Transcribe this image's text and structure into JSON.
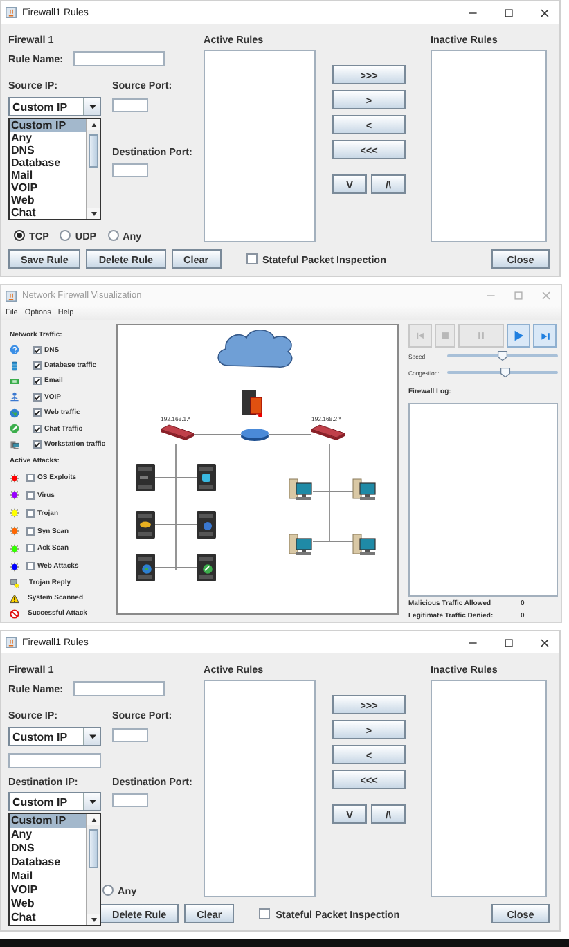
{
  "windows": [
    {
      "kind": "rules",
      "title": "Firewall1 Rules",
      "heading": "Firewall 1",
      "rule_name_label": "Rule Name:",
      "source_ip": {
        "label": "Source IP:",
        "value": "Custom IP",
        "list_open": true
      },
      "source_port_label": "Source Port:",
      "destination_port_label": "Destination Port:",
      "open_list": {
        "options": [
          {
            "label": "Custom IP",
            "selected": true
          },
          {
            "label": "Any",
            "selected": false
          },
          {
            "label": "DNS",
            "selected": false
          },
          {
            "label": "Database",
            "selected": false
          },
          {
            "label": "Mail",
            "selected": false
          },
          {
            "label": "VOIP",
            "selected": false
          },
          {
            "label": "Web",
            "selected": false
          },
          {
            "label": "Chat",
            "selected": false
          }
        ]
      },
      "protocols": [
        {
          "label": "TCP",
          "selected": true
        },
        {
          "label": "UDP",
          "selected": false
        },
        {
          "label": "Any",
          "selected": false
        }
      ],
      "active_rules_label": "Active Rules",
      "inactive_rules_label": "Inactive Rules",
      "move_buttons": [
        ">>>",
        ">",
        "<",
        "<<<"
      ],
      "order_buttons": [
        "V",
        "/\\"
      ],
      "actions": [
        "Save Rule",
        "Delete Rule",
        "Clear"
      ],
      "stateful_inspection": {
        "label": "Stateful Packet Inspection",
        "checked": false
      },
      "close_button": "Close"
    },
    {
      "kind": "visualization",
      "title": "Network Firewall Visualization",
      "menu": [
        "File",
        "Options",
        "Help"
      ],
      "traffic_heading": "Network Traffic:",
      "traffic": [
        {
          "kind": "dns",
          "label": "DNS",
          "checked": true
        },
        {
          "kind": "database",
          "label": "Database traffic",
          "checked": true
        },
        {
          "kind": "email",
          "label": "Email",
          "checked": true
        },
        {
          "kind": "voip",
          "label": "VOIP",
          "checked": true
        },
        {
          "kind": "web",
          "label": "Web traffic",
          "checked": true
        },
        {
          "kind": "chat",
          "label": "Chat Traffic",
          "checked": true
        },
        {
          "kind": "workstation",
          "label": "Workstation traffic",
          "checked": true
        }
      ],
      "attacks_heading": "Active Attacks:",
      "attacks": [
        {
          "label": "OS Exploits",
          "color": "#ff0000",
          "checked": false
        },
        {
          "label": "Virus",
          "color": "#9900ff",
          "checked": false
        },
        {
          "label": "Trojan",
          "color": "#ffff00",
          "checked": false
        },
        {
          "label": "Syn Scan",
          "color": "#ff6600",
          "checked": false
        },
        {
          "label": "Ack Scan",
          "color": "#33ff00",
          "checked": false
        },
        {
          "label": "Web Attacks",
          "color": "#0000ff",
          "checked": false
        }
      ],
      "legend": [
        {
          "kind": "trojan_reply",
          "label": "Trojan Reply"
        },
        {
          "kind": "scanned",
          "label": "System Scanned"
        },
        {
          "kind": "attack",
          "label": "Successful Attack"
        }
      ],
      "diagram": {
        "subnets": [
          "192.168.1.*",
          "192.168.2.*"
        ]
      },
      "playback": [
        {
          "kind": "rewind",
          "disabled": true
        },
        {
          "kind": "stop",
          "disabled": true
        },
        {
          "kind": "pause",
          "disabled": true
        },
        {
          "kind": "play",
          "disabled": false
        },
        {
          "kind": "step",
          "disabled": false
        }
      ],
      "sliders": [
        {
          "label": "Speed:",
          "level": 0.5
        },
        {
          "label": "Congestion:",
          "level": 0.53
        }
      ],
      "log_label": "Firewall Log:",
      "stats": [
        {
          "label": "Malicious Traffic Allowed",
          "value": "0"
        },
        {
          "label": "Legitimate Traffic Denied:",
          "value": "0"
        }
      ]
    },
    {
      "kind": "rules",
      "title": "Firewall1 Rules",
      "heading": "Firewall 1",
      "rule_name_label": "Rule Name:",
      "source_ip": {
        "label": "Source IP:",
        "value": "Custom IP",
        "custom_field": true
      },
      "source_port_label": "Source Port:",
      "destination_ip": {
        "label": "Destination IP:",
        "value": "Custom IP",
        "list_open": true
      },
      "destination_port_label": "Destination Port:",
      "open_list": {
        "options": [
          {
            "label": "Custom IP",
            "selected": true
          },
          {
            "label": "Any",
            "selected": false
          },
          {
            "label": "DNS",
            "selected": false
          },
          {
            "label": "Database",
            "selected": false
          },
          {
            "label": "Mail",
            "selected": false
          },
          {
            "label": "VOIP",
            "selected": false
          },
          {
            "label": "Web",
            "selected": false
          },
          {
            "label": "Chat",
            "selected": false
          }
        ]
      },
      "protocols": [
        {
          "label": "Any",
          "selected": false
        }
      ],
      "active_rules_label": "Active Rules",
      "inactive_rules_label": "Inactive Rules",
      "move_buttons": [
        ">>>",
        ">",
        "<",
        "<<<"
      ],
      "order_buttons": [
        "V",
        "/\\"
      ],
      "actions": [
        "Delete Rule",
        "Clear"
      ],
      "stateful_inspection": {
        "label": "Stateful Packet Inspection",
        "checked": false
      },
      "close_button": "Close"
    }
  ]
}
